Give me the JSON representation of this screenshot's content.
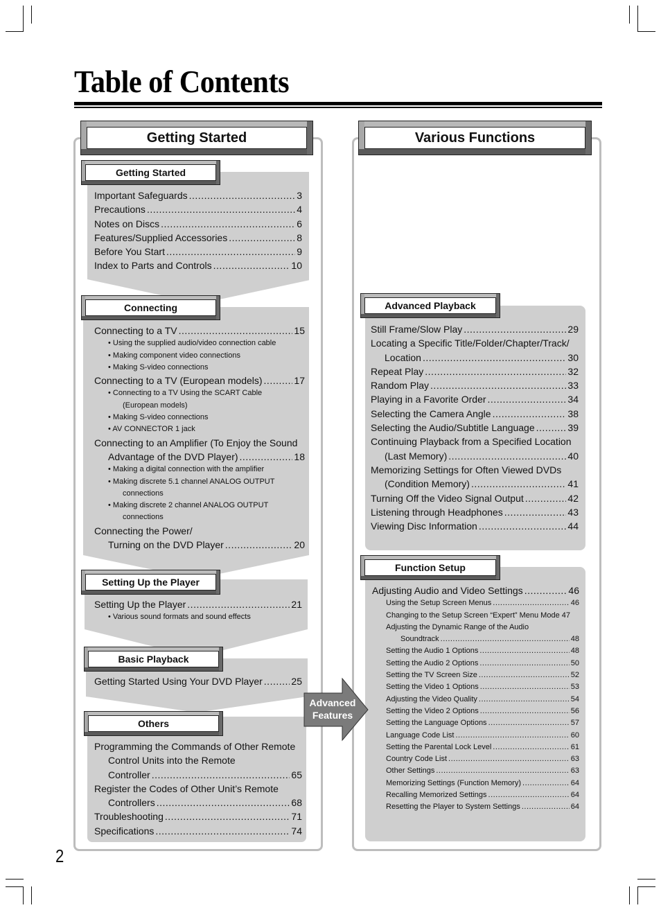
{
  "page": {
    "title": "Table of Contents",
    "page_number": "2"
  },
  "left_column": {
    "header": "Getting Started",
    "sections": [
      {
        "title": "Getting Started",
        "entries": [
          {
            "text": "Important Safeguards",
            "page": "3"
          },
          {
            "text": "Precautions",
            "page": "4"
          },
          {
            "text": "Notes on Discs",
            "page": "6"
          },
          {
            "text": "Features/Supplied Accessories",
            "page": "8"
          },
          {
            "text": "Before You Start",
            "page": "9"
          },
          {
            "text": "Index to Parts and Controls",
            "page": "10"
          }
        ]
      },
      {
        "title": "Connecting",
        "entries": [
          {
            "text": "Connecting to a TV",
            "page": "15",
            "subitems": [
              "Using the supplied audio/video connection cable",
              "Making component video connections",
              "Making S-video connections"
            ]
          },
          {
            "text": "Connecting to a TV (European models)",
            "page": "17",
            "subitems": [
              "Connecting to a TV Using the SCART Cable",
              "(European models)",
              "Making S-video connections",
              "AV CONNECTOR 1 jack"
            ]
          },
          {
            "text_line1": "Connecting to an Amplifier (To Enjoy the Sound",
            "text": "Advantage of the DVD Player)",
            "page": "18",
            "subitems": [
              "Making a digital connection with the amplifier",
              "Making discrete 5.1 channel ANALOG OUTPUT",
              "connections",
              "Making discrete 2 channel ANALOG OUTPUT",
              "connections"
            ]
          },
          {
            "text_line1": "Connecting the Power/",
            "text": "Turning on the DVD Player",
            "page": "20"
          }
        ]
      },
      {
        "title": "Setting Up the Player",
        "entries": [
          {
            "text": "Setting Up the Player",
            "page": "21",
            "subitems": [
              "Various sound formats and sound effects"
            ]
          }
        ]
      },
      {
        "title": "Basic Playback",
        "entries": [
          {
            "text": "Getting Started Using Your DVD Player",
            "page": "25"
          }
        ]
      },
      {
        "title": "Others",
        "entries": [
          {
            "text_line1": "Programming the Commands of Other Remote",
            "text_line2": "Control Units into the Remote",
            "text": "Controller",
            "page": "65"
          },
          {
            "text_line1": "Register the Codes of Other Unit’s Remote",
            "text": "Controllers",
            "page": "68"
          },
          {
            "text": "Troubleshooting",
            "page": "71"
          },
          {
            "text": "Specifications",
            "page": "74"
          }
        ]
      }
    ]
  },
  "arrow": {
    "label_line1": "Advanced",
    "label_line2": "Features"
  },
  "right_column": {
    "header": "Various Functions",
    "sections": [
      {
        "title": "Advanced Playback",
        "entries": [
          {
            "text": "Still Frame/Slow Play",
            "page": "29"
          },
          {
            "text_line1": "Locating a Specific Title/Folder/Chapter/Track/",
            "text": "Location",
            "page": "30"
          },
          {
            "text": "Repeat Play",
            "page": "32"
          },
          {
            "text": "Random Play",
            "page": "33"
          },
          {
            "text": "Playing in a Favorite Order",
            "page": "34"
          },
          {
            "text": "Selecting the Camera Angle",
            "page": "38"
          },
          {
            "text": "Selecting the Audio/Subtitle Language",
            "page": "39"
          },
          {
            "text_line1": "Continuing Playback from a Specified Location",
            "text": "(Last Memory)",
            "page": "40"
          },
          {
            "text_line1": "Memorizing Settings for Often Viewed DVDs",
            "text": "(Condition Memory)",
            "page": "41"
          },
          {
            "text": "Turning Off the Video Signal Output",
            "page": "42"
          },
          {
            "text": "Listening through Headphones",
            "page": "43"
          },
          {
            "text": "Viewing Disc Information",
            "page": "44"
          }
        ]
      },
      {
        "title": "Function Setup",
        "main_entry": {
          "text": "Adjusting Audio and Video Settings",
          "page": "46"
        },
        "entries": [
          {
            "text": "Using the Setup Screen Menus",
            "page": "46"
          },
          {
            "text": "Changing to the Setup Screen “Expert” Menu Mode",
            "page": "47"
          },
          {
            "text_line1": "Adjusting the Dynamic Range of the Audio",
            "text": "Soundtrack",
            "page": "48"
          },
          {
            "text": "Setting the Audio 1 Options",
            "page": "48"
          },
          {
            "text": "Setting the Audio 2 Options",
            "page": "50"
          },
          {
            "text": "Setting the TV Screen Size",
            "page": "52"
          },
          {
            "text": "Setting the Video 1 Options",
            "page": "53"
          },
          {
            "text": "Adjusting the Video Quality",
            "page": "54"
          },
          {
            "text": "Setting the Video 2 Options",
            "page": "56"
          },
          {
            "text": "Setting the Language Options",
            "page": "57"
          },
          {
            "text": "Language Code List",
            "page": "60"
          },
          {
            "text": "Setting the Parental Lock Level",
            "page": "61"
          },
          {
            "text": "Country Code List",
            "page": "63"
          },
          {
            "text": "Other Settings",
            "page": "63"
          },
          {
            "text": "Memorizing Settings (Function Memory)",
            "page": "64"
          },
          {
            "text": "Recalling Memorized Settings",
            "page": "64"
          },
          {
            "text": "Resetting the Player to System Settings",
            "page": "64"
          }
        ]
      }
    ]
  }
}
